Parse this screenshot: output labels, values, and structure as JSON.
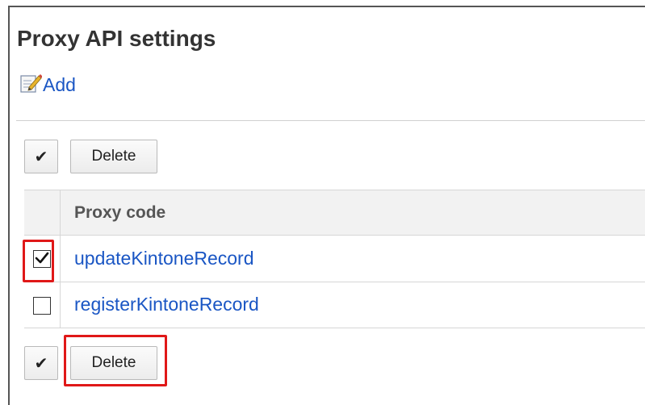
{
  "page": {
    "title": "Proxy API settings",
    "add_label": "Add"
  },
  "toolbar_top": {
    "check_all_label": "✔",
    "delete_label": "Delete"
  },
  "table": {
    "column_header": "Proxy code",
    "rows": [
      {
        "code": "updateKintoneRecord",
        "checked": true
      },
      {
        "code": "registerKintoneRecord",
        "checked": false
      }
    ]
  },
  "toolbar_bottom": {
    "check_all_label": "✔",
    "delete_label": "Delete"
  },
  "colors": {
    "link": "#1a56c4",
    "highlight": "#e01818"
  }
}
